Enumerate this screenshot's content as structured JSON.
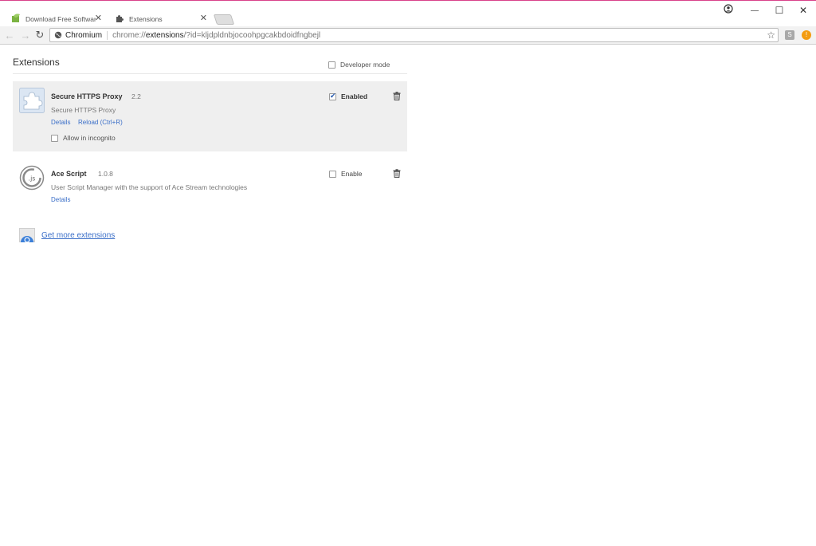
{
  "tabs": [
    {
      "title": "Download Free Software",
      "close": "✕",
      "icon": "leaf-favicon-icon",
      "active": false
    },
    {
      "title": "Extensions",
      "close": "✕",
      "icon": "puzzle-favicon-icon",
      "active": true
    }
  ],
  "window": {
    "profile_icon": "account-icon",
    "minimize": "—",
    "maximize": "☐",
    "close": "✕"
  },
  "toolbar": {
    "back": "←",
    "forward": "→",
    "reload": "↻",
    "site_label": "Chromium",
    "url_scheme": "chrome://",
    "url_host": "extensions",
    "url_rest": "/?id=kljdpldnbjocoohpgcakbdoidfngbejl",
    "star": "☆",
    "ext1_label": "S",
    "ext2_label": "!"
  },
  "page": {
    "title": "Extensions",
    "developer_mode_label": "Developer mode",
    "developer_mode_checked": false
  },
  "extensions": [
    {
      "name": "Secure HTTPS Proxy",
      "version": "2.2",
      "description": "Secure HTTPS Proxy",
      "details_label": "Details",
      "reload_label": "Reload (Ctrl+R)",
      "incognito_label": "Allow in incognito",
      "enable_label": "Enabled",
      "enabled": true,
      "icon": "puzzle-icon"
    },
    {
      "name": "Ace Script",
      "version": "1.0.8",
      "description": "User Script Manager with the support of Ace Stream technologies",
      "details_label": "Details",
      "enable_label": "Enable",
      "enabled": false,
      "icon": "ace-script-icon"
    }
  ],
  "get_more": {
    "label": "Get more extensions",
    "icon": "web-store-icon"
  },
  "colors": {
    "link": "#3b6fc8",
    "accent_top": "#d9428a",
    "highlight_bg": "#efefef"
  }
}
